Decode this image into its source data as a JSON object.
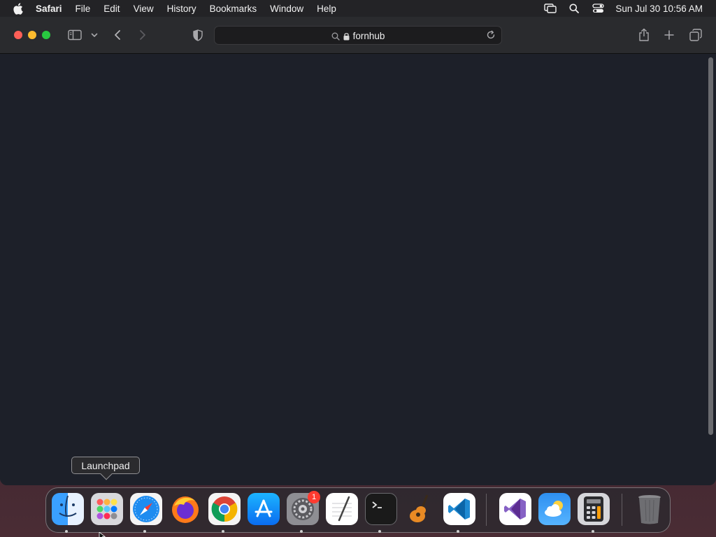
{
  "menubar": {
    "app": "Safari",
    "items": [
      "File",
      "Edit",
      "View",
      "History",
      "Bookmarks",
      "Window",
      "Help"
    ],
    "clock": "Sun Jul 30  10:56 AM",
    "status_icons": [
      "screen-mirroring-icon",
      "spotlight-search-icon",
      "control-center-icon"
    ]
  },
  "toolbar": {
    "url": "fornhub",
    "icons": [
      "sidebar-icon",
      "chevron-down-icon",
      "back-icon",
      "forward-icon",
      "privacy-shield-icon",
      "share-icon",
      "new-tab-icon",
      "tab-overview-icon"
    ]
  },
  "dock": {
    "tooltip": "Launchpad",
    "apps": [
      "Finder",
      "Launchpad",
      "Safari",
      "Firefox",
      "Chrome",
      "App Store",
      "System Settings",
      "TextEdit",
      "Terminal",
      "GarageBand",
      "Visual Studio Code",
      "Visual Studio",
      "Weather",
      "Calculator",
      "Trash"
    ],
    "settings_badge": "1"
  },
  "colors": {
    "page_background": "#1d2029",
    "toolbar_background": "#2a2b2e",
    "traffic_close": "#fe5f57",
    "traffic_minimize": "#febc2e",
    "traffic_maximize": "#28c840",
    "badge": "#ff3b30"
  }
}
